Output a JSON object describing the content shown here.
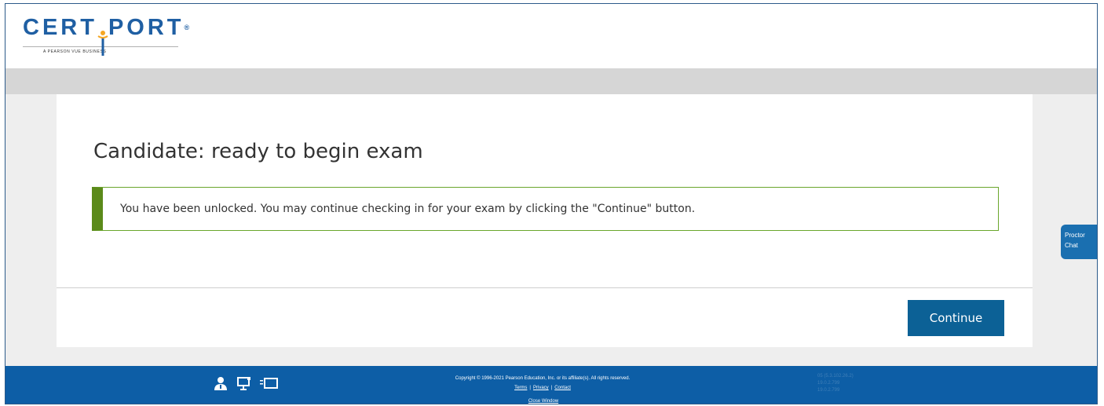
{
  "header": {
    "logo_text": "CERT¦PORT",
    "logo_subtitle": "A PEARSON VUE BUSINESS"
  },
  "main": {
    "title": "Candidate: ready to begin exam",
    "notice": "You have been unlocked. You may continue checking in for your exam by clicking the \"Continue\" button.",
    "continue_label": "Continue"
  },
  "proctor_chat": {
    "line1": "Proctor",
    "line2": "Chat"
  },
  "footer": {
    "copyright": "Copyright © 1996-2021 Pearson Education, Inc. or its affiliate(s). All rights reserved.",
    "links": [
      "Terms",
      "Privacy",
      "Contact"
    ],
    "close_window": "Close Window",
    "versions": [
      "05 (5.3.102.26.2)",
      "19.0.2.799",
      "19.0.2.799"
    ]
  },
  "colors": {
    "brand_blue": "#1f5fa3",
    "footer_blue": "#0d5ea6",
    "button_blue": "#0c6196",
    "notice_green": "#5b8a1a"
  },
  "icons": [
    "person-icon",
    "computer-icon",
    "screen-icon"
  ]
}
